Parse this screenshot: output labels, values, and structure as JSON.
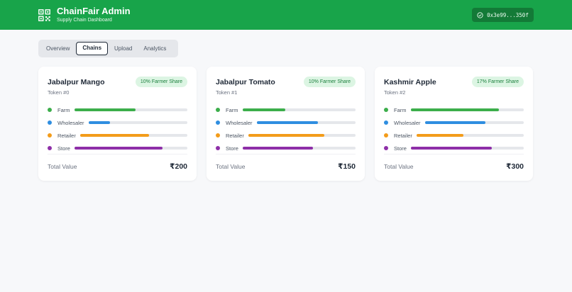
{
  "header": {
    "title": "ChainFair Admin",
    "subtitle": "Supply Chain Dashboard",
    "wallet": "0x3e99...350f",
    "brand_color": "#18a44a",
    "logo_icon": "qr-code-icon",
    "wallet_icon": "check-circle-icon"
  },
  "tabs": [
    {
      "label": "Overview",
      "active": false
    },
    {
      "label": "Chains",
      "active": true
    },
    {
      "label": "Upload",
      "active": false
    },
    {
      "label": "Analytics",
      "active": false
    }
  ],
  "stage_colors": {
    "farm": "#3cae4b",
    "wholesaler": "#2f8ee0",
    "retailer": "#f39c1a",
    "store": "#8e2fa8"
  },
  "cards": [
    {
      "title": "Jabalpur Mango",
      "token": "Token #0",
      "share": "10% Farmer Share",
      "total_label": "Total Value",
      "total_value": "₹200",
      "stages": [
        {
          "key": "farm",
          "label": "Farm",
          "level": 0.54
        },
        {
          "key": "wholesaler",
          "label": "Wholesaler",
          "level": 0.22
        },
        {
          "key": "retailer",
          "label": "Retailer",
          "level": 0.64
        },
        {
          "key": "store",
          "label": "Store",
          "level": 0.78
        }
      ]
    },
    {
      "title": "Jabalpur Tomato",
      "token": "Token #1",
      "share": "10% Farmer Share",
      "total_label": "Total Value",
      "total_value": "₹150",
      "stages": [
        {
          "key": "farm",
          "label": "Farm",
          "level": 0.38
        },
        {
          "key": "wholesaler",
          "label": "Wholesaler",
          "level": 0.62
        },
        {
          "key": "retailer",
          "label": "Retailer",
          "level": 0.71
        },
        {
          "key": "store",
          "label": "Store",
          "level": 0.62
        }
      ]
    },
    {
      "title": "Kashmir Apple",
      "token": "Token #2",
      "share": "17% Farmer Share",
      "total_label": "Total Value",
      "total_value": "₹300",
      "stages": [
        {
          "key": "farm",
          "label": "Farm",
          "level": 0.78
        },
        {
          "key": "wholesaler",
          "label": "Wholesaler",
          "level": 0.61
        },
        {
          "key": "retailer",
          "label": "Retailer",
          "level": 0.44
        },
        {
          "key": "store",
          "label": "Store",
          "level": 0.72
        }
      ]
    }
  ]
}
